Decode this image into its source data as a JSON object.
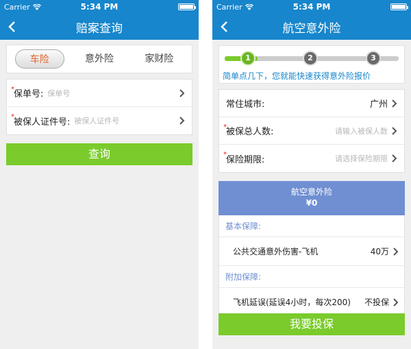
{
  "status": {
    "carrier": "Carrier",
    "time": "5:34 PM"
  },
  "left": {
    "title": "赔案查询",
    "tabs": [
      {
        "label": "车险",
        "active": true
      },
      {
        "label": "意外险",
        "active": false
      },
      {
        "label": "家财险",
        "active": false
      }
    ],
    "fields": [
      {
        "required": "*",
        "label": "保单号:",
        "placeholder": "保单号"
      },
      {
        "required": "*",
        "label": "被保人证件号:",
        "placeholder": "被保人证件号"
      }
    ],
    "query_button": "查询"
  },
  "right": {
    "title": "航空意外险",
    "steps": [
      "1",
      "2",
      "3"
    ],
    "step_hint": "简单点几下，您就能快速获得意外险报价",
    "fields": [
      {
        "required": "",
        "label": "常住城市:",
        "value": "广州",
        "placeholder": ""
      },
      {
        "required": "*",
        "label": "被保总人数:",
        "value": "",
        "placeholder": "请输入被保人数"
      },
      {
        "required": "*",
        "label": "保险期限:",
        "value": "",
        "placeholder": "请选择保险期限"
      }
    ],
    "summary": {
      "name": "航空意外险",
      "price": "¥0"
    },
    "basic_section": "基本保障:",
    "basic_item": {
      "label": "公共交通意外伤害-飞机",
      "value": "40万"
    },
    "extra_section": "附加保障:",
    "extra_item": {
      "label": "飞机延误(延误4小时，每次200)",
      "value": "不投保"
    },
    "buy_button": "我要投保"
  },
  "colors": {
    "nav": "#1786cc",
    "green": "#7acb2b",
    "summary": "#6f8fd2",
    "active_tab": "#e0622b"
  }
}
